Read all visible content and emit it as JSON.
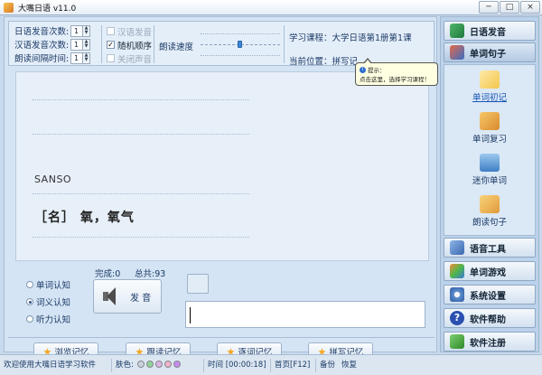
{
  "window": {
    "title": "大嘴日语 v11.0",
    "minimize": "─",
    "maximize": "□",
    "close": "×"
  },
  "toolbar": {
    "jp_count_label": "日语发音次数:",
    "jp_count_value": "1",
    "cn_count_label": "汉语发音次数:",
    "cn_count_value": "1",
    "interval_label": "朗读间隔时间:",
    "interval_value": "1",
    "chk_chinese": "汉语发音",
    "chk_random": "随机顺序",
    "chk_mute": "关闭声音",
    "speed_label": "朗读速度",
    "speed_level": 0.5,
    "course": "学习课程：大学日语第1册第1课",
    "position": "当前位置：拼写记"
  },
  "tooltip": {
    "head": "提示：",
    "body": "点击这里，选择学习课程！"
  },
  "word": {
    "kana": "SANSO",
    "meaning": "［名］ 氧，氧气"
  },
  "modes": {
    "word": "单词认知",
    "meaning": "词义认知",
    "listen": "听力认知"
  },
  "stats": {
    "done": "完成:0",
    "total": "总共:93"
  },
  "speak": {
    "label": "发 音"
  },
  "memory_buttons": {
    "browse": "浏览记忆",
    "follow": "跟读记忆",
    "word": "逐词记忆",
    "spell": "拼写记忆"
  },
  "sidebar": {
    "jp_speech": "日语发音",
    "word_sentence": "单词句子",
    "sub": {
      "first": "单词初记",
      "review": "单词复习",
      "mini": "迷你单词",
      "read": "朗读句子"
    },
    "tools": "语音工具",
    "games": "单词游戏",
    "settings": "系统设置",
    "help": "软件帮助",
    "register": "软件注册"
  },
  "status": {
    "welcome": "欢迎使用大嘴日语学习软件",
    "skin": "肤色:",
    "time": "时间 [00:00:18]",
    "home": "首页[F12]",
    "backup": "备份",
    "restore": "恢复"
  },
  "colors": {
    "accent": "#1a56b4",
    "skins": [
      "#c7d3df",
      "#8fd39a",
      "#ddb3e6",
      "#f0b1cc",
      "#c58bf0"
    ]
  },
  "icons": {
    "jp_speech": "book-icon",
    "word_sentence": "books-icon",
    "tools": "tools-icon",
    "games": "puzzle-icon",
    "settings": "gear-icon",
    "help": "help-icon",
    "register": "register-icon"
  }
}
